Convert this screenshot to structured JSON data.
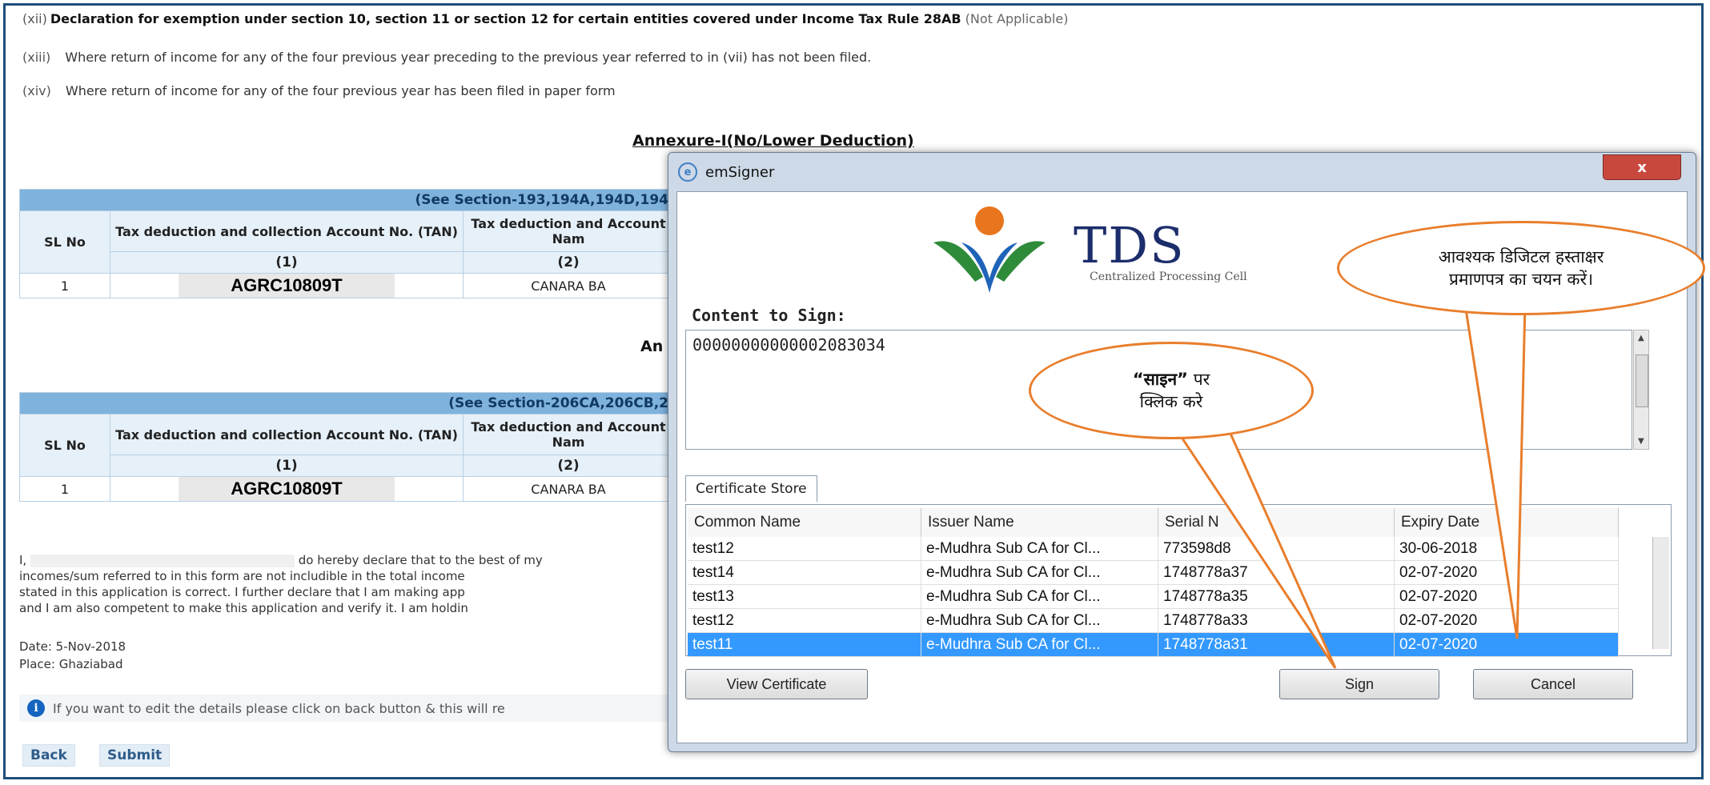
{
  "form": {
    "line12_num": "(xii)",
    "line12_bold": "Declaration for exemption under section 10, section 11 or section 12 for certain entities covered under Income Tax Rule 28AB",
    "line12_muted": "(Not Applicable)",
    "line13_num": "(xiii)",
    "line13_text": "Where return of income for any of the four previous year preceding to the previous year referred to in (vii) has not been filed.",
    "line14_num": "(xiv)",
    "line14_text": "Where return of income for any of the four previous year has been filed in paper form",
    "annexure1_title": "Annexure-I(No/Lower Deduction)",
    "annexure2_title": "An",
    "table1": {
      "section_header": "(See Section-193,194A,194D,194",
      "col_sl": "SL No",
      "col_tan": "Tax deduction and collection Account No. (TAN)",
      "col_name": "Tax deduction and Account Nam",
      "sub1": "(1)",
      "sub2": "(2)",
      "row_sl": "1",
      "row_tan": "AGRC10809T",
      "row_name": "CANARA BA"
    },
    "table2": {
      "section_header": "(See Section-206CA,206CB,2",
      "col_sl": "SL No",
      "col_tan": "Tax deduction and collection Account No. (TAN)",
      "col_name": "Tax deduction and Account Nam",
      "sub1": "(1)",
      "sub2": "(2)",
      "row_sl": "1",
      "row_tan": "AGRC10809T",
      "row_name": "CANARA BA"
    },
    "decl_start": "I,",
    "decl_l1": "do hereby declare that to the best of my",
    "decl_l2": "incomes/sum referred to in this form are not includible in the total income",
    "decl_l3": "stated in this application is correct. I further declare that I am making app",
    "decl_l4": "and I am also competent to make this application and verify it. I am holdin",
    "date": "Date: 5-Nov-2018",
    "place": "Place: Ghaziabad",
    "info_text": "If you want to edit the details please click on back button & this will re",
    "back_label": "Back",
    "submit_label": "Submit"
  },
  "dialog": {
    "title": "emSigner",
    "close_label": "x",
    "logo_text": "TDS",
    "logo_sub": "Centralized Processing Cell",
    "content_label": "Content to Sign:",
    "content_value": "00000000000002083034",
    "tab_label": "Certificate Store",
    "columns": [
      "Common Name",
      "Issuer Name",
      "Serial N",
      "Expiry Date"
    ],
    "rows": [
      {
        "cn": "test12",
        "issuer": "e-Mudhra Sub CA for Cl...",
        "serial": "773598d8",
        "expiry": "30-06-2018"
      },
      {
        "cn": "test14",
        "issuer": "e-Mudhra Sub CA for Cl...",
        "serial": "1748778a37",
        "expiry": "02-07-2020"
      },
      {
        "cn": "test13",
        "issuer": "e-Mudhra Sub CA for Cl...",
        "serial": "1748778a35",
        "expiry": "02-07-2020"
      },
      {
        "cn": "test12",
        "issuer": "e-Mudhra Sub CA for Cl...",
        "serial": "1748778a33",
        "expiry": "02-07-2020"
      },
      {
        "cn": "test11",
        "issuer": "e-Mudhra Sub CA for Cl...",
        "serial": "1748778a31",
        "expiry": "02-07-2020"
      }
    ],
    "selected_row": 4,
    "view_cert_label": "View Certificate",
    "sign_label": "Sign",
    "cancel_label": "Cancel"
  },
  "callouts": {
    "sign_bold": "“साइन”",
    "sign_rest": "पर",
    "sign_line2": "क्लिक करे",
    "cert_line1": "आवश्यक डिजिटल हस्ताक्षर",
    "cert_line2": "प्रमाणपत्र का चयन करें।"
  },
  "colors": {
    "accent": "#e87e2c",
    "selection": "#3399ff",
    "table_header": "#7fb2dc"
  }
}
